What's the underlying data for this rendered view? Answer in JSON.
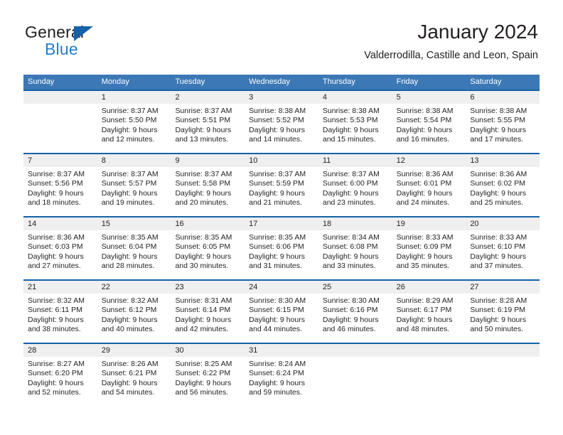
{
  "brand": {
    "name_part1": "General",
    "name_part2": "Blue",
    "triangle_color": "#1562ab",
    "blue_color": "#1f7ed0"
  },
  "header": {
    "title": "January 2024",
    "subtitle": "Valderrodilla, Castille and Leon, Spain"
  },
  "theme": {
    "header_row_bg": "#3b78b5",
    "week_separator": "#1562ab",
    "day_number_bg": "#efefef",
    "text": "#231f20"
  },
  "weekdays": [
    "Sunday",
    "Monday",
    "Tuesday",
    "Wednesday",
    "Thursday",
    "Friday",
    "Saturday"
  ],
  "weeks": [
    [
      {
        "day": "",
        "sunrise": "",
        "sunset": "",
        "daylight1": "",
        "daylight2": ""
      },
      {
        "day": "1",
        "sunrise": "Sunrise: 8:37 AM",
        "sunset": "Sunset: 5:50 PM",
        "daylight1": "Daylight: 9 hours",
        "daylight2": "and 12 minutes."
      },
      {
        "day": "2",
        "sunrise": "Sunrise: 8:37 AM",
        "sunset": "Sunset: 5:51 PM",
        "daylight1": "Daylight: 9 hours",
        "daylight2": "and 13 minutes."
      },
      {
        "day": "3",
        "sunrise": "Sunrise: 8:38 AM",
        "sunset": "Sunset: 5:52 PM",
        "daylight1": "Daylight: 9 hours",
        "daylight2": "and 14 minutes."
      },
      {
        "day": "4",
        "sunrise": "Sunrise: 8:38 AM",
        "sunset": "Sunset: 5:53 PM",
        "daylight1": "Daylight: 9 hours",
        "daylight2": "and 15 minutes."
      },
      {
        "day": "5",
        "sunrise": "Sunrise: 8:38 AM",
        "sunset": "Sunset: 5:54 PM",
        "daylight1": "Daylight: 9 hours",
        "daylight2": "and 16 minutes."
      },
      {
        "day": "6",
        "sunrise": "Sunrise: 8:38 AM",
        "sunset": "Sunset: 5:55 PM",
        "daylight1": "Daylight: 9 hours",
        "daylight2": "and 17 minutes."
      }
    ],
    [
      {
        "day": "7",
        "sunrise": "Sunrise: 8:37 AM",
        "sunset": "Sunset: 5:56 PM",
        "daylight1": "Daylight: 9 hours",
        "daylight2": "and 18 minutes."
      },
      {
        "day": "8",
        "sunrise": "Sunrise: 8:37 AM",
        "sunset": "Sunset: 5:57 PM",
        "daylight1": "Daylight: 9 hours",
        "daylight2": "and 19 minutes."
      },
      {
        "day": "9",
        "sunrise": "Sunrise: 8:37 AM",
        "sunset": "Sunset: 5:58 PM",
        "daylight1": "Daylight: 9 hours",
        "daylight2": "and 20 minutes."
      },
      {
        "day": "10",
        "sunrise": "Sunrise: 8:37 AM",
        "sunset": "Sunset: 5:59 PM",
        "daylight1": "Daylight: 9 hours",
        "daylight2": "and 21 minutes."
      },
      {
        "day": "11",
        "sunrise": "Sunrise: 8:37 AM",
        "sunset": "Sunset: 6:00 PM",
        "daylight1": "Daylight: 9 hours",
        "daylight2": "and 23 minutes."
      },
      {
        "day": "12",
        "sunrise": "Sunrise: 8:36 AM",
        "sunset": "Sunset: 6:01 PM",
        "daylight1": "Daylight: 9 hours",
        "daylight2": "and 24 minutes."
      },
      {
        "day": "13",
        "sunrise": "Sunrise: 8:36 AM",
        "sunset": "Sunset: 6:02 PM",
        "daylight1": "Daylight: 9 hours",
        "daylight2": "and 25 minutes."
      }
    ],
    [
      {
        "day": "14",
        "sunrise": "Sunrise: 8:36 AM",
        "sunset": "Sunset: 6:03 PM",
        "daylight1": "Daylight: 9 hours",
        "daylight2": "and 27 minutes."
      },
      {
        "day": "15",
        "sunrise": "Sunrise: 8:35 AM",
        "sunset": "Sunset: 6:04 PM",
        "daylight1": "Daylight: 9 hours",
        "daylight2": "and 28 minutes."
      },
      {
        "day": "16",
        "sunrise": "Sunrise: 8:35 AM",
        "sunset": "Sunset: 6:05 PM",
        "daylight1": "Daylight: 9 hours",
        "daylight2": "and 30 minutes."
      },
      {
        "day": "17",
        "sunrise": "Sunrise: 8:35 AM",
        "sunset": "Sunset: 6:06 PM",
        "daylight1": "Daylight: 9 hours",
        "daylight2": "and 31 minutes."
      },
      {
        "day": "18",
        "sunrise": "Sunrise: 8:34 AM",
        "sunset": "Sunset: 6:08 PM",
        "daylight1": "Daylight: 9 hours",
        "daylight2": "and 33 minutes."
      },
      {
        "day": "19",
        "sunrise": "Sunrise: 8:33 AM",
        "sunset": "Sunset: 6:09 PM",
        "daylight1": "Daylight: 9 hours",
        "daylight2": "and 35 minutes."
      },
      {
        "day": "20",
        "sunrise": "Sunrise: 8:33 AM",
        "sunset": "Sunset: 6:10 PM",
        "daylight1": "Daylight: 9 hours",
        "daylight2": "and 37 minutes."
      }
    ],
    [
      {
        "day": "21",
        "sunrise": "Sunrise: 8:32 AM",
        "sunset": "Sunset: 6:11 PM",
        "daylight1": "Daylight: 9 hours",
        "daylight2": "and 38 minutes."
      },
      {
        "day": "22",
        "sunrise": "Sunrise: 8:32 AM",
        "sunset": "Sunset: 6:12 PM",
        "daylight1": "Daylight: 9 hours",
        "daylight2": "and 40 minutes."
      },
      {
        "day": "23",
        "sunrise": "Sunrise: 8:31 AM",
        "sunset": "Sunset: 6:14 PM",
        "daylight1": "Daylight: 9 hours",
        "daylight2": "and 42 minutes."
      },
      {
        "day": "24",
        "sunrise": "Sunrise: 8:30 AM",
        "sunset": "Sunset: 6:15 PM",
        "daylight1": "Daylight: 9 hours",
        "daylight2": "and 44 minutes."
      },
      {
        "day": "25",
        "sunrise": "Sunrise: 8:30 AM",
        "sunset": "Sunset: 6:16 PM",
        "daylight1": "Daylight: 9 hours",
        "daylight2": "and 46 minutes."
      },
      {
        "day": "26",
        "sunrise": "Sunrise: 8:29 AM",
        "sunset": "Sunset: 6:17 PM",
        "daylight1": "Daylight: 9 hours",
        "daylight2": "and 48 minutes."
      },
      {
        "day": "27",
        "sunrise": "Sunrise: 8:28 AM",
        "sunset": "Sunset: 6:19 PM",
        "daylight1": "Daylight: 9 hours",
        "daylight2": "and 50 minutes."
      }
    ],
    [
      {
        "day": "28",
        "sunrise": "Sunrise: 8:27 AM",
        "sunset": "Sunset: 6:20 PM",
        "daylight1": "Daylight: 9 hours",
        "daylight2": "and 52 minutes."
      },
      {
        "day": "29",
        "sunrise": "Sunrise: 8:26 AM",
        "sunset": "Sunset: 6:21 PM",
        "daylight1": "Daylight: 9 hours",
        "daylight2": "and 54 minutes."
      },
      {
        "day": "30",
        "sunrise": "Sunrise: 8:25 AM",
        "sunset": "Sunset: 6:22 PM",
        "daylight1": "Daylight: 9 hours",
        "daylight2": "and 56 minutes."
      },
      {
        "day": "31",
        "sunrise": "Sunrise: 8:24 AM",
        "sunset": "Sunset: 6:24 PM",
        "daylight1": "Daylight: 9 hours",
        "daylight2": "and 59 minutes."
      },
      {
        "day": "",
        "sunrise": "",
        "sunset": "",
        "daylight1": "",
        "daylight2": ""
      },
      {
        "day": "",
        "sunrise": "",
        "sunset": "",
        "daylight1": "",
        "daylight2": ""
      },
      {
        "day": "",
        "sunrise": "",
        "sunset": "",
        "daylight1": "",
        "daylight2": ""
      }
    ]
  ]
}
